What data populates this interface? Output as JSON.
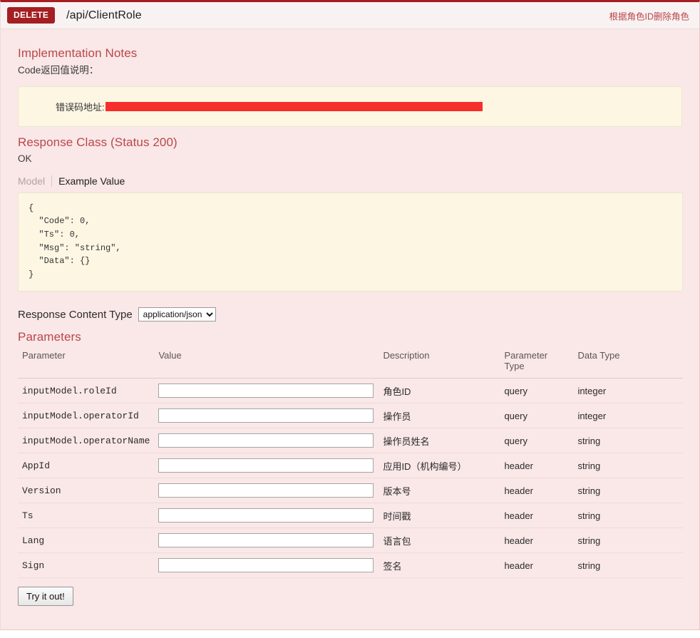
{
  "operation": {
    "method": "DELETE",
    "path": "/api/ClientRole",
    "summary": "根据角色ID删除角色"
  },
  "implementation_notes": {
    "title": "Implementation Notes",
    "description": "Code返回值说明：",
    "note_label": "错误码地址:",
    "note_redacted": true
  },
  "response_class": {
    "title": "Response Class (Status 200)",
    "status_text": "OK",
    "tabs": {
      "model": "Model",
      "example_value": "Example Value"
    },
    "example_value": "{\n  \"Code\": 0,\n  \"Ts\": 0,\n  \"Msg\": \"string\",\n  \"Data\": {}\n}"
  },
  "content_type": {
    "label": "Response Content Type",
    "selected": "application/json",
    "options": [
      "application/json"
    ]
  },
  "parameters": {
    "title": "Parameters",
    "headers": {
      "parameter": "Parameter",
      "value": "Value",
      "description": "Description",
      "parameter_type": "Parameter Type",
      "data_type": "Data Type"
    },
    "rows": [
      {
        "parameter": "inputModel.roleId",
        "value": "",
        "placeholder": "",
        "description": "角色ID",
        "parameter_type": "query",
        "data_type": "integer"
      },
      {
        "parameter": "inputModel.operatorId",
        "value": "",
        "placeholder": "",
        "description": "操作员",
        "parameter_type": "query",
        "data_type": "integer"
      },
      {
        "parameter": "inputModel.operatorName",
        "value": "",
        "placeholder": "",
        "description": "操作员姓名",
        "parameter_type": "query",
        "data_type": "string"
      },
      {
        "parameter": "AppId",
        "value": "",
        "placeholder": "",
        "description": "应用ID（机构编号）",
        "parameter_type": "header",
        "data_type": "string"
      },
      {
        "parameter": "Version",
        "value": "",
        "placeholder": "",
        "description": "版本号",
        "parameter_type": "header",
        "data_type": "string"
      },
      {
        "parameter": "Ts",
        "value": "",
        "placeholder": "",
        "description": "时间戳",
        "parameter_type": "header",
        "data_type": "string"
      },
      {
        "parameter": "Lang",
        "value": "",
        "placeholder": "",
        "description": "语言包",
        "parameter_type": "header",
        "data_type": "string"
      },
      {
        "parameter": "Sign",
        "value": "",
        "placeholder": "",
        "description": "签名",
        "parameter_type": "header",
        "data_type": "string"
      }
    ]
  },
  "actions": {
    "try_it_out": "Try it out!"
  },
  "colors": {
    "method_delete": "#a41e22",
    "panel_background": "#fae7e7",
    "heading_background": "#f9f2f2",
    "code_background": "#fcf6e3",
    "accent_heading": "#b9474b",
    "redaction": "#f72f2a"
  }
}
